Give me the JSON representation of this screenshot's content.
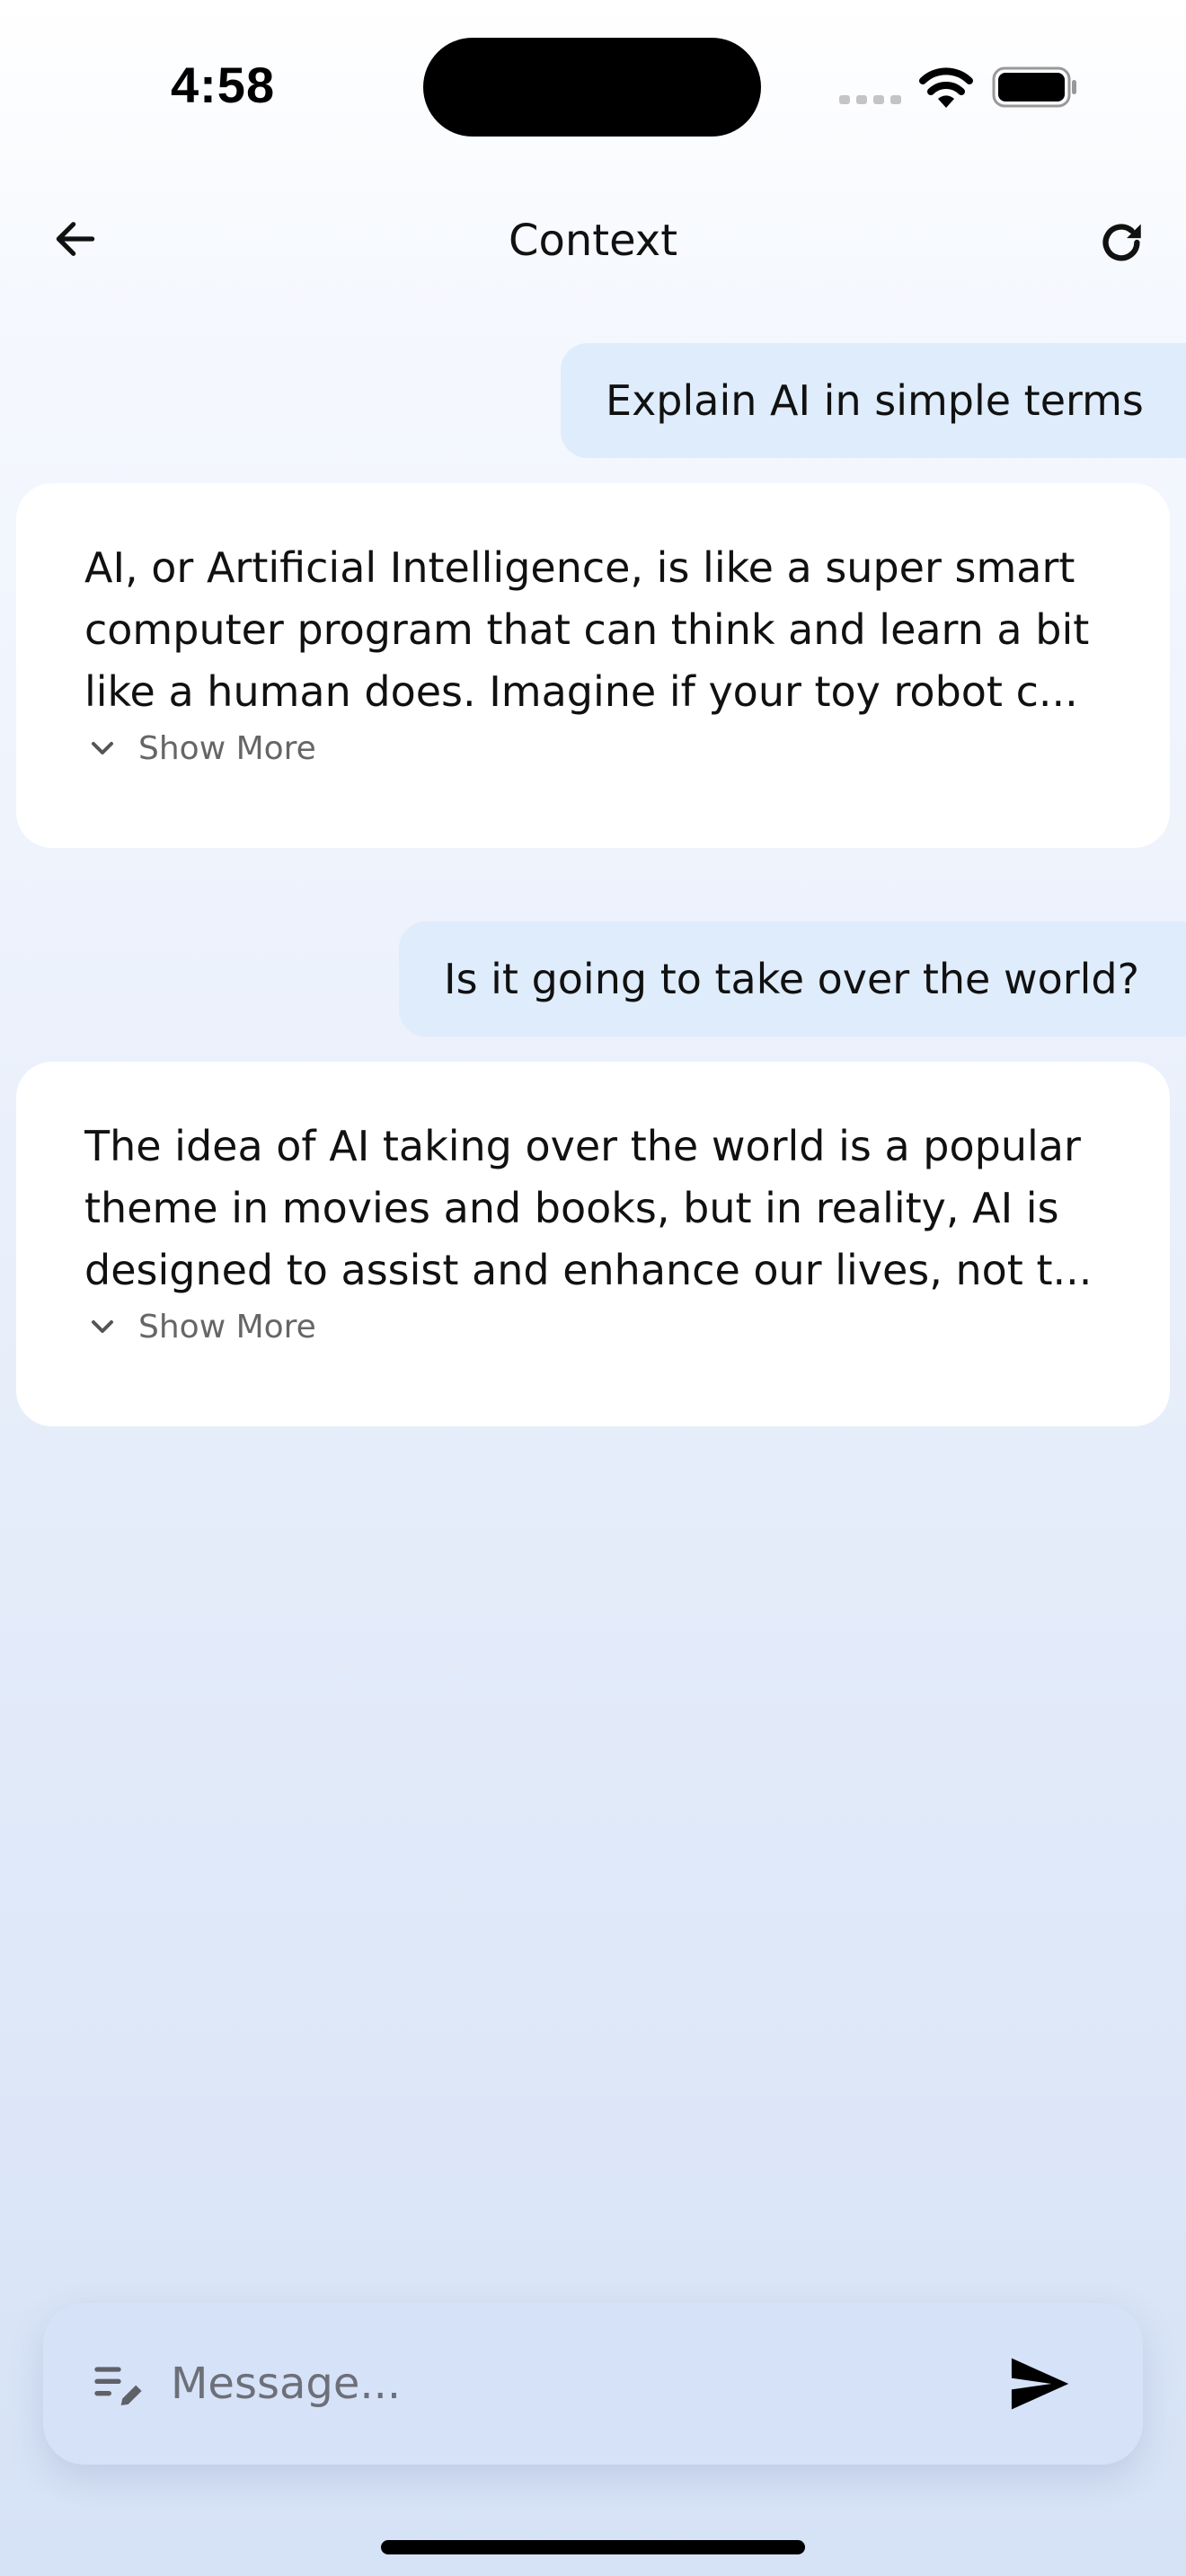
{
  "status_bar": {
    "time": "4:58"
  },
  "header": {
    "title": "Context",
    "back_icon": "arrow-left-icon",
    "refresh_icon": "refresh-icon"
  },
  "conversation": [
    {
      "role": "user",
      "text": "Explain AI in simple terms"
    },
    {
      "role": "assistant",
      "text": "AI, or Artificial Intelligence, is like a super smart computer program that can think and learn a bit like a human does. Imagine if your toy robot c...",
      "show_more_label": "Show More"
    },
    {
      "role": "user",
      "text": "Is it going to take over the world?"
    },
    {
      "role": "assistant",
      "text": "The idea of AI taking over the world is a popular theme in movies and books, but in reality, AI is designed to assist and enhance our lives, not t...",
      "show_more_label": "Show More"
    }
  ],
  "composer": {
    "placeholder": "Message...",
    "value": "",
    "compose_icon": "notes-edit-icon",
    "send_icon": "send-icon"
  },
  "colors": {
    "user_bubble": "#dfecfb",
    "assistant_card": "#ffffff",
    "input_bar": "#d6e2f8",
    "muted_text": "#666666"
  }
}
